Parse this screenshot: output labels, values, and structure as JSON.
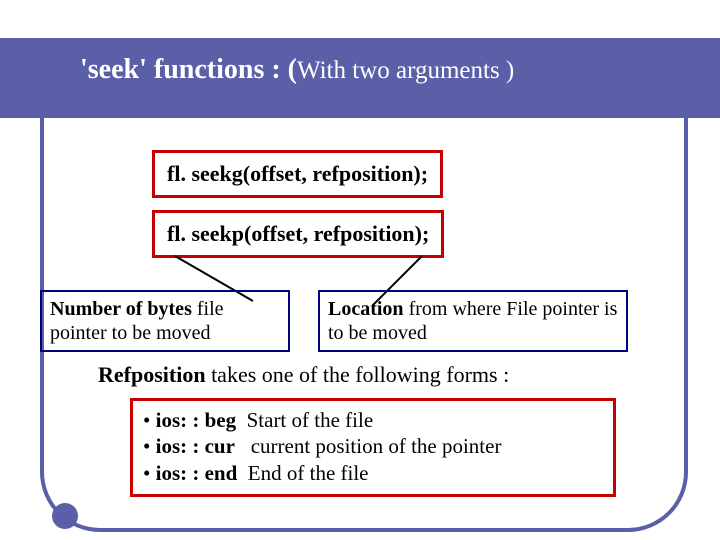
{
  "title": {
    "main": "'seek' functions : (",
    "sub": "With two arguments )"
  },
  "codebox1": "fl. seekg(offset, refposition);",
  "codebox2": "fl. seekp(offset, refposition);",
  "calloutLeft": {
    "bold": "Number of bytes",
    "rest": " file pointer to be moved"
  },
  "calloutRight": {
    "bold": "Location",
    "rest": " from where File pointer is to be moved"
  },
  "refpos": {
    "bold": "Refposition",
    "rest": " takes one of the following forms :"
  },
  "ios": {
    "row1": {
      "bullet": "• ",
      "key": "ios: : beg",
      "desc": "  Start of the file"
    },
    "row2": {
      "bullet": "• ",
      "key": "ios: : cur",
      "desc": "   current position of the pointer"
    },
    "row3": {
      "bullet": "• ",
      "key": "ios: : end",
      "desc": "  End of the file"
    }
  }
}
